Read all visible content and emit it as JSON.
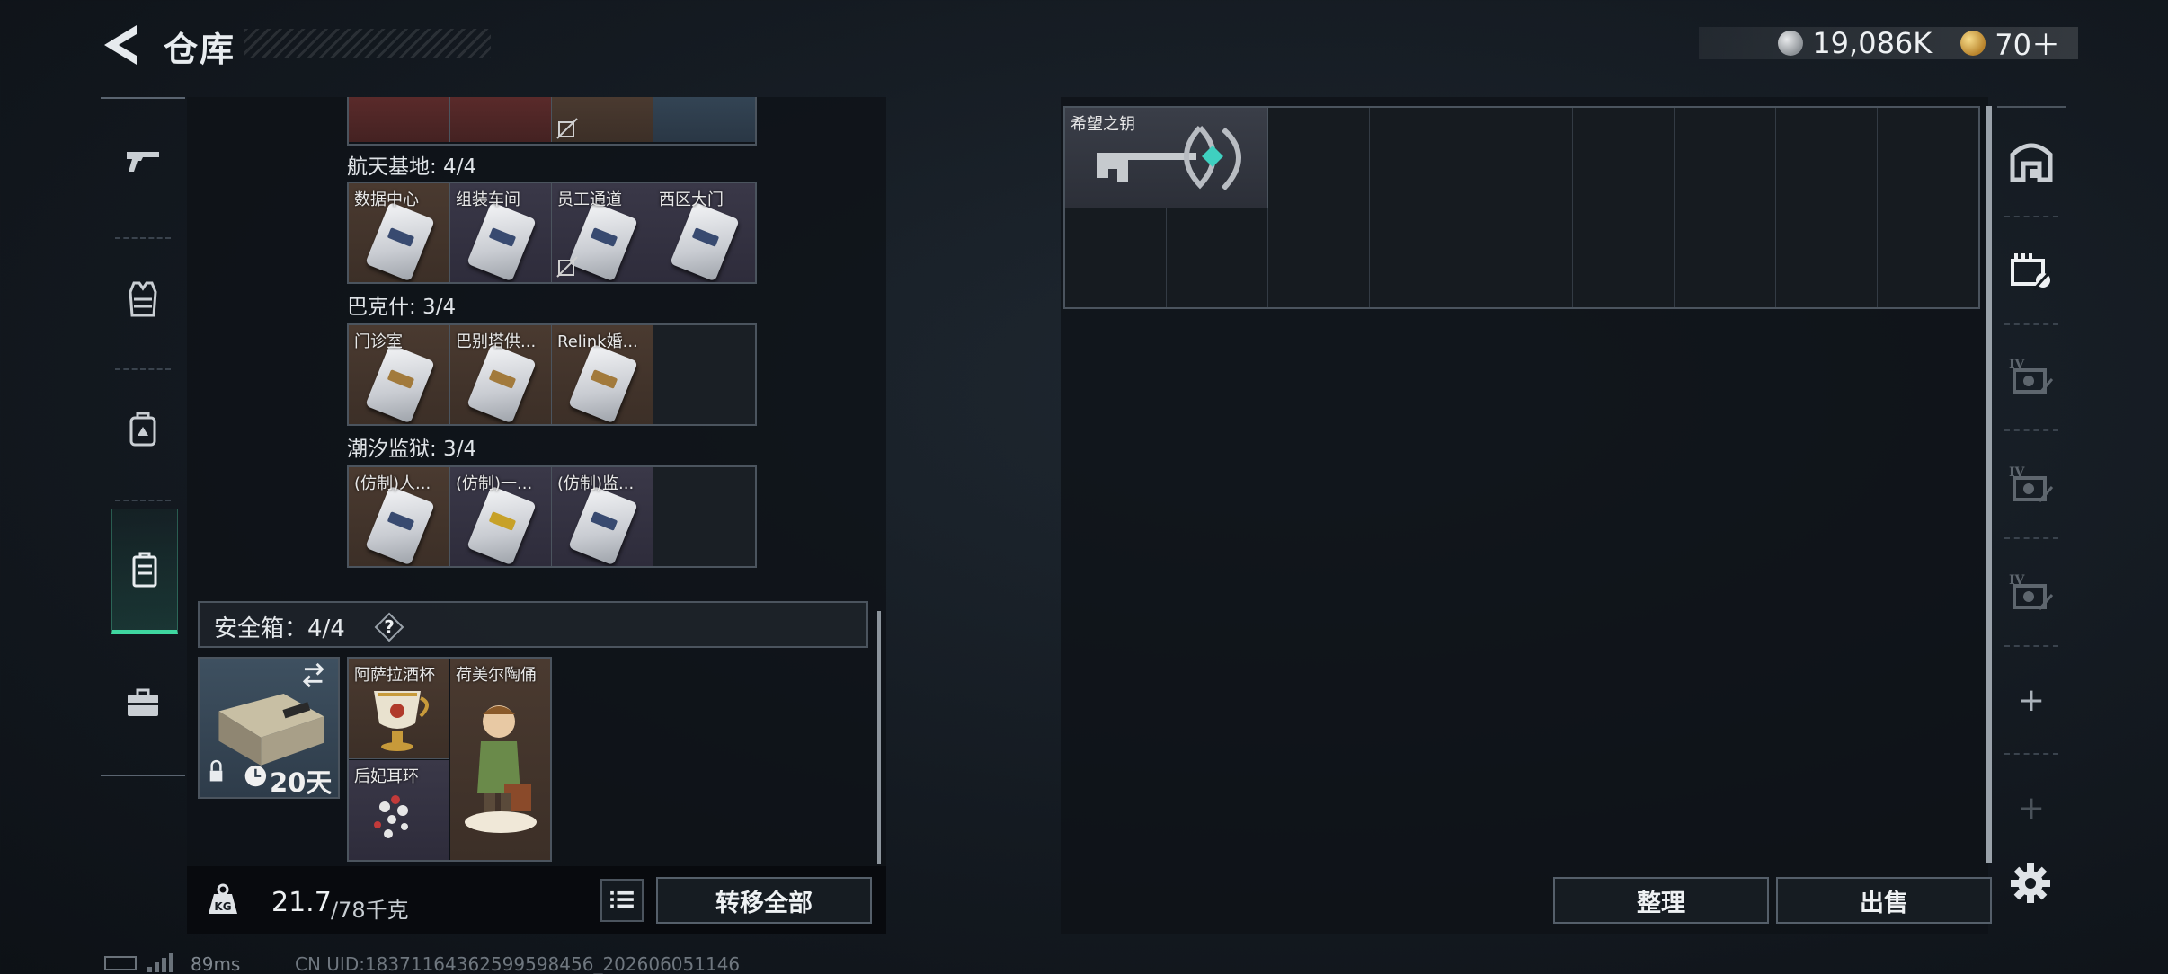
{
  "header": {
    "title": "仓库",
    "currencies": [
      {
        "icon": "silver-coin-icon",
        "value": "19,086K"
      },
      {
        "icon": "gold-coin-icon",
        "value": "70＋"
      }
    ]
  },
  "left_nav": {
    "items": [
      {
        "name": "nav-weapons",
        "icon": "pistol-icon"
      },
      {
        "name": "nav-armor",
        "icon": "vest-icon"
      },
      {
        "name": "nav-backpack",
        "icon": "backpack-icon"
      },
      {
        "name": "nav-keycase",
        "icon": "keycase-icon",
        "active": true
      },
      {
        "name": "nav-toolbox",
        "icon": "toolbox-icon"
      }
    ]
  },
  "key_groups": [
    {
      "label": "航天基地: 4/4",
      "cells": [
        {
          "name": "数据中心",
          "color": "brown",
          "card": "plain"
        },
        {
          "name": "组装车间",
          "color": "purple",
          "card": "plain"
        },
        {
          "name": "员工通道",
          "color": "purple",
          "card": "plain",
          "no_card": true
        },
        {
          "name": "西区大门",
          "color": "purple",
          "card": "plain"
        }
      ]
    },
    {
      "label": "巴克什: 3/4",
      "cells": [
        {
          "name": "门诊室",
          "color": "brown",
          "card": "gold"
        },
        {
          "name": "巴别塔供...",
          "color": "brown",
          "card": "gold"
        },
        {
          "name": "Relink婚...",
          "color": "brown",
          "card": "gold"
        },
        {
          "name": "",
          "color": "empty"
        }
      ]
    },
    {
      "label": "潮汐监狱: 3/4",
      "cells": [
        {
          "name": "(仿制)人...",
          "color": "brown",
          "card": "plain"
        },
        {
          "name": "(仿制)一...",
          "color": "purple",
          "card": "yellow"
        },
        {
          "name": "(仿制)监...",
          "color": "purple",
          "card": "plain"
        },
        {
          "name": "",
          "color": "empty"
        }
      ]
    }
  ],
  "safebox": {
    "label": "安全箱：4/4",
    "help": "?",
    "days": "20天",
    "items": [
      {
        "name": "阿萨拉酒杯"
      },
      {
        "name": "荷美尔陶俑"
      },
      {
        "name": "后妃耳环"
      }
    ]
  },
  "weight": {
    "current": "21.7",
    "max": "/78千克"
  },
  "buttons": {
    "transfer_all": "转移全部",
    "sort": "整理",
    "sell": "出售"
  },
  "storage": {
    "items": [
      {
        "name": "希望之钥"
      }
    ]
  },
  "right_tabs": [
    {
      "name": "tab-storage-main",
      "icon": "vault-icon"
    },
    {
      "name": "tab-keys",
      "icon": "key-tab-icon"
    },
    {
      "name": "tab-iv-1",
      "icon": "iv-case-icon",
      "label": "IV"
    },
    {
      "name": "tab-iv-2",
      "icon": "iv-case-icon",
      "label": "IV"
    },
    {
      "name": "tab-iv-3",
      "icon": "iv-case-icon",
      "label": "IV"
    },
    {
      "name": "tab-add",
      "label": "+"
    },
    {
      "name": "tab-add-disabled",
      "label": "+"
    }
  ],
  "footer": {
    "ping": "89ms",
    "uid": "CN UID:18371164362599598456_202606051146"
  }
}
